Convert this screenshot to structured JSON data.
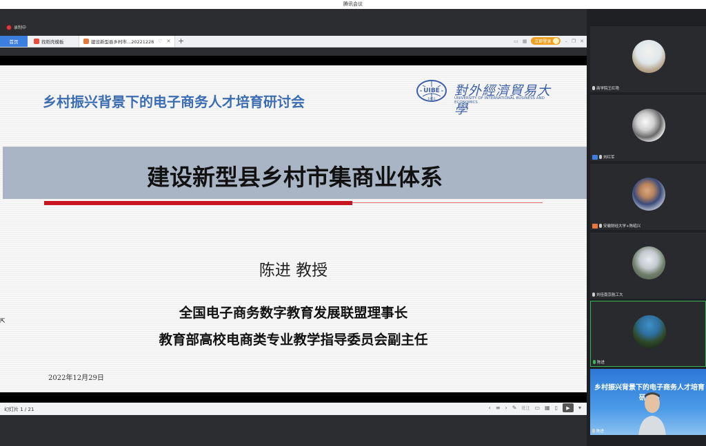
{
  "window": {
    "title": "腾讯会议"
  },
  "recording": {
    "label": "录制中"
  },
  "tabs": {
    "home": "首页",
    "template": "找稻壳模板",
    "document": "建设新型县乡村市...20221228",
    "new_tab": "+"
  },
  "toolbar": {
    "login_label": "立即登录"
  },
  "slide": {
    "header": "乡村振兴背景下的电子商务人才培育研讨会",
    "logo": {
      "cn": "對外經濟貿易大學",
      "en": "UNIVERSITY OF INTERNATIONAL BUSINESS AND ECONOMICS",
      "seal_text": "UIBE",
      "seal_year": "1951"
    },
    "title": "建设新型县乡村市集商业体系",
    "author": "陈进  教授",
    "role1": "全国电子商务数字教育发展联盟理事长",
    "role2": "教育部高校电商类专业教学指导委员会副主任",
    "date": "2022年12月29日"
  },
  "statusbar": {
    "slide_number": "幻灯片 1 / 21",
    "annotate_label": "批注"
  },
  "participants": [
    {
      "name": "商学院王红艳",
      "mic": "muted",
      "badge": ""
    },
    {
      "name": "刘红军",
      "mic": "muted",
      "badge": "user"
    },
    {
      "name": "安徽财经大学+陈昭兴",
      "mic": "muted",
      "badge": "user-orange"
    },
    {
      "name": "刘佳南京航工大",
      "mic": "muted",
      "badge": ""
    },
    {
      "name": "陈进",
      "mic": "speaking",
      "badge": ""
    },
    {
      "name": "陈进",
      "mic": "muted",
      "badge": "",
      "video_title": "乡村振兴背景下的电子商务人才培育研讨会"
    }
  ],
  "colors": {
    "header_blue": "#3c6db3",
    "title_band": "#a9b5c5",
    "accent_red": "#c8141e",
    "tab_blue": "#3c7de0",
    "active_green": "#3ab55a"
  }
}
